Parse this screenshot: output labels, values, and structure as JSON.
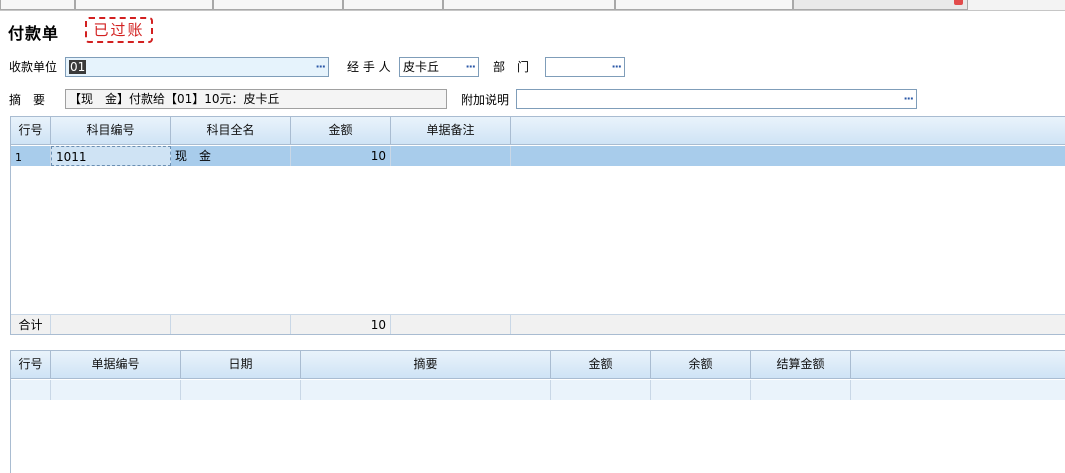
{
  "title": "付款单",
  "stamp": "已过账",
  "form": {
    "payee_label": "收款单位",
    "payee_value": "01",
    "handler_label": "经 手 人",
    "handler_value": "皮卡丘",
    "dept_label": "部　门",
    "dept_value": "",
    "summary_label": "摘　要",
    "summary_value": "【现　金】付款给【01】10元：皮卡丘",
    "note_label": "附加说明",
    "note_value": "",
    "ellipsis": "···"
  },
  "grid1": {
    "columns": [
      "行号",
      "科目编号",
      "科目全名",
      "金额",
      "单据备注"
    ],
    "rows": [
      {
        "line": "1",
        "code": "1011",
        "name": "现　金",
        "amount": "10",
        "remark": ""
      }
    ],
    "footer": {
      "label": "合计",
      "amount": "10"
    }
  },
  "grid2": {
    "columns": [
      "行号",
      "单据编号",
      "日期",
      "摘要",
      "金额",
      "余额",
      "结算金额"
    ]
  }
}
